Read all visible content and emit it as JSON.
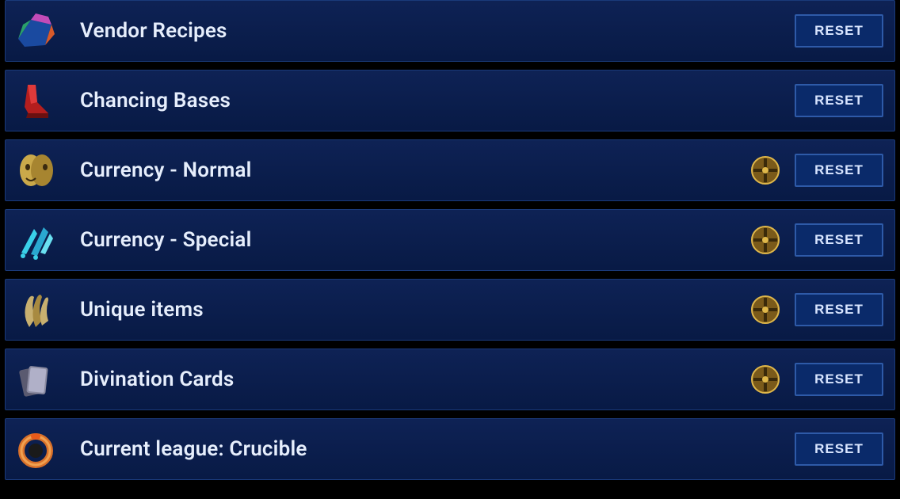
{
  "reset_label": "RESET",
  "rows": [
    {
      "id": "vendor-recipes",
      "label": "Vendor Recipes",
      "has_orb": false,
      "icon": "prism"
    },
    {
      "id": "chancing-bases",
      "label": "Chancing Bases",
      "has_orb": false,
      "icon": "boots"
    },
    {
      "id": "currency-normal",
      "label": "Currency - Normal",
      "has_orb": true,
      "icon": "mask"
    },
    {
      "id": "currency-special",
      "label": "Currency - Special",
      "has_orb": true,
      "icon": "splinter"
    },
    {
      "id": "unique-items",
      "label": "Unique items",
      "has_orb": true,
      "icon": "claw"
    },
    {
      "id": "divination-cards",
      "label": "Divination Cards",
      "has_orb": true,
      "icon": "cards"
    },
    {
      "id": "current-league",
      "label": "Current league: Crucible",
      "has_orb": false,
      "icon": "ring"
    }
  ]
}
